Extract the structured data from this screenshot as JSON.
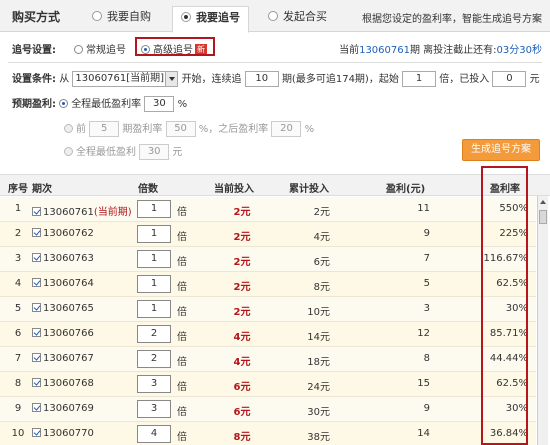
{
  "tabs": {
    "title": "购买方式",
    "items": [
      "我要自购",
      "我要追号",
      "发起合买"
    ],
    "tip": "根据您设定的盈利率，智能生成追号方案"
  },
  "mode": {
    "label": "追号设置:",
    "options": [
      "常规追号",
      "高级追号"
    ],
    "new_badge": "新",
    "period_prefix": "当前",
    "period": "13060761",
    "period_suffix": "期 离投注截止还有:",
    "countdown": "03分30秒"
  },
  "settings": {
    "cond_label": "设置条件:",
    "from": "从",
    "start_period": "13060761[当前期]",
    "start_text": "开始，连续追",
    "periods": "10",
    "periods_unit": "期(最多可追174期)，起始",
    "start_mult": "1",
    "mult_text": "倍，已投入",
    "invested": "0",
    "yuan": "元",
    "expect_label": "预期盈利:",
    "opt1_label": "全程最低盈利率",
    "opt1_value": "30",
    "pct": "%",
    "opt2_prefix": "前",
    "opt2_periods": "5",
    "opt2_text": "期盈利率",
    "opt2_value": "50",
    "opt2_mid": "%，之后盈利率",
    "opt2_value2": "20",
    "opt3_label": "全程最低盈利",
    "opt3_value": "30",
    "opt3_unit": "元",
    "generate": "生成追号方案"
  },
  "table": {
    "headers": [
      "序号",
      "期次",
      "倍数",
      "当前投入",
      "累计投入",
      "盈利(元)",
      "盈利率"
    ],
    "mult_unit": "倍",
    "current_tag": "(当前期)",
    "rows": [
      {
        "no": "1",
        "period": "13060761",
        "mult": "1",
        "cur": "2元",
        "total": "2元",
        "profit": "11",
        "rate": "550%"
      },
      {
        "no": "2",
        "period": "13060762",
        "mult": "1",
        "cur": "2元",
        "total": "4元",
        "profit": "9",
        "rate": "225%"
      },
      {
        "no": "3",
        "period": "13060763",
        "mult": "1",
        "cur": "2元",
        "total": "6元",
        "profit": "7",
        "rate": "116.67%"
      },
      {
        "no": "4",
        "period": "13060764",
        "mult": "1",
        "cur": "2元",
        "total": "8元",
        "profit": "5",
        "rate": "62.5%"
      },
      {
        "no": "5",
        "period": "13060765",
        "mult": "1",
        "cur": "2元",
        "total": "10元",
        "profit": "3",
        "rate": "30%"
      },
      {
        "no": "6",
        "period": "13060766",
        "mult": "2",
        "cur": "4元",
        "total": "14元",
        "profit": "12",
        "rate": "85.71%"
      },
      {
        "no": "7",
        "period": "13060767",
        "mult": "2",
        "cur": "4元",
        "total": "18元",
        "profit": "8",
        "rate": "44.44%"
      },
      {
        "no": "8",
        "period": "13060768",
        "mult": "3",
        "cur": "6元",
        "total": "24元",
        "profit": "15",
        "rate": "62.5%"
      },
      {
        "no": "9",
        "period": "13060769",
        "mult": "3",
        "cur": "6元",
        "total": "30元",
        "profit": "9",
        "rate": "30%"
      },
      {
        "no": "10",
        "period": "13060770",
        "mult": "4",
        "cur": "8元",
        "total": "38元",
        "profit": "14",
        "rate": "36.84%"
      }
    ]
  },
  "colors": {
    "accent_red": "#b3161b",
    "button_orange": "#f39a3a",
    "link_blue": "#1e5fb8"
  }
}
